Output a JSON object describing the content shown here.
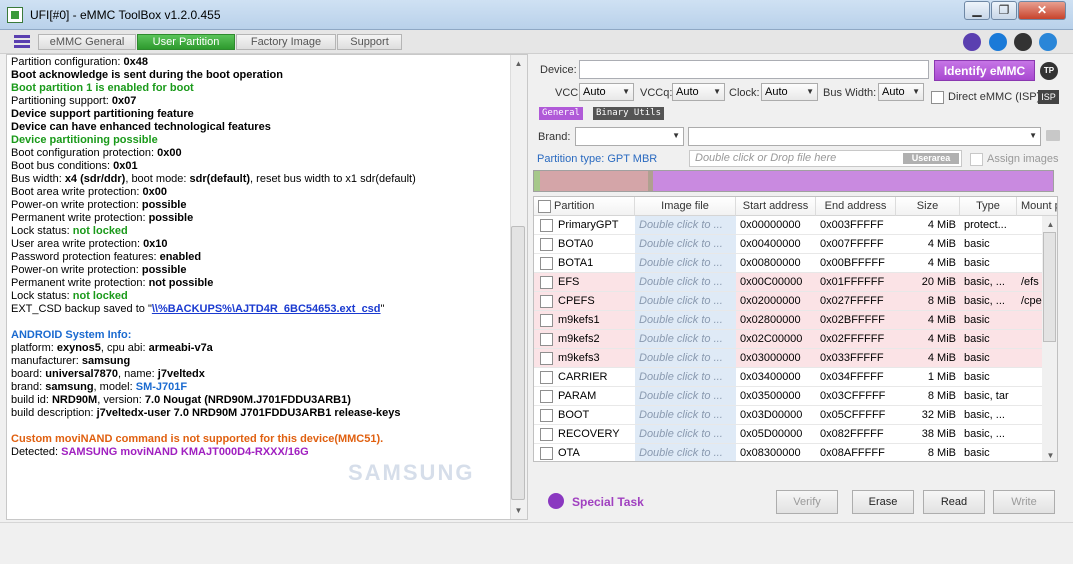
{
  "window": {
    "title": "UFI[#0] - eMMC ToolBox v1.2.0.455",
    "min": "▁",
    "restore": "❐",
    "close": "✕"
  },
  "tabs": [
    {
      "label": "eMMC General",
      "active": false
    },
    {
      "label": "User Partition",
      "active": true
    },
    {
      "label": "Factory Image",
      "active": false
    },
    {
      "label": "Support",
      "active": false
    }
  ],
  "log": {
    "lines": [
      {
        "p": "Partition configuration: ",
        "v": "0x48",
        "c": "b"
      },
      {
        "p": "",
        "v": " Boot acknowledge is sent during the boot operation",
        "c": "b"
      },
      {
        "p": "",
        "v": " Boot partition 1 is enabled for boot",
        "c": "green"
      },
      {
        "p": "Partitioning support: ",
        "v": "0x07",
        "c": "b"
      },
      {
        "p": "",
        "v": " Device support partitioning feature",
        "c": "b"
      },
      {
        "p": "",
        "v": " Device can have enhanced technological features",
        "c": "b"
      },
      {
        "p": "",
        "v": " Device partitioning possible",
        "c": "green"
      },
      {
        "p": "Boot configuration protection: ",
        "v": "0x00",
        "c": "b"
      },
      {
        "p": "Boot bus conditions: ",
        "v": "0x01",
        "c": "b"
      },
      {
        "p": " Bus width: ",
        "v": "x4 (sdr/ddr)",
        "c": "b",
        "p2": ", boot mode: ",
        "v2": "sdr(default)",
        "s": ", reset bus width to x1 sdr(default)"
      },
      {
        "p": "Boot area write protection: ",
        "v": "0x00",
        "c": "b"
      },
      {
        "p": " Power-on write protection: ",
        "v": "possible",
        "c": "b"
      },
      {
        "p": " Permanent write protection: ",
        "v": "possible",
        "c": "b"
      },
      {
        "p": " Lock status: ",
        "v": "not locked",
        "c": "green"
      },
      {
        "p": "User area write protection: ",
        "v": "0x10",
        "c": "b"
      },
      {
        "p": " Password protection features: ",
        "v": "enabled",
        "c": "b"
      },
      {
        "p": " Power-on write protection: ",
        "v": "possible",
        "c": "b"
      },
      {
        "p": " Permanent write protection: ",
        "v": "not possible",
        "c": "b"
      },
      {
        "p": " Lock status: ",
        "v": "not locked",
        "c": "green"
      },
      {
        "p": "EXT_CSD backup saved to \"",
        "v": "\\\\%BACKUPS%\\AJTD4R_6BC54653.ext_csd",
        "c": "link",
        "s": "\""
      },
      {
        "p": "",
        "v": "",
        "c": "blank"
      },
      {
        "p": "",
        "v": " ANDROID System Info:",
        "c": "blue"
      },
      {
        "p": " platform: ",
        "v": "exynos5",
        "c": "b",
        "p2": ", cpu abi: ",
        "v2": "armeabi-v7a"
      },
      {
        "p": " manufacturer: ",
        "v": "samsung",
        "c": "b"
      },
      {
        "p": " board: ",
        "v": "universal7870",
        "c": "b",
        "p2": ", name: ",
        "v2": "j7veltedx"
      },
      {
        "p": " brand: ",
        "v": "samsung",
        "c": "b",
        "p2": ", model: ",
        "v2": "SM-J701F",
        "c2": "blue"
      },
      {
        "p": " build id: ",
        "v": "NRD90M",
        "c": "b",
        "p2": ", version: ",
        "v2": "7.0 Nougat (NRD90M.J701FDDU3ARB1)"
      },
      {
        "p": " build description: ",
        "v": "j7veltedx-user 7.0 NRD90M J701FDDU3ARB1 release-keys",
        "c": "b"
      },
      {
        "p": "",
        "v": "",
        "c": "blank"
      },
      {
        "p": "",
        "v": "Custom moviNAND command is not supported for this device(MMC51).",
        "c": "orange"
      },
      {
        "p": "Detected: ",
        "v": "SAMSUNG moviNAND KMAJT000D4-RXXX/16G",
        "c": "magenta"
      }
    ],
    "watermark": "SAMSUNG"
  },
  "device": {
    "label": "Device:",
    "value": "",
    "identify_label": "Identify eMMC",
    "tp_label": "TP",
    "vcc_label": "VCC:",
    "vcc_value": "Auto",
    "vccq_label": "VCCq:",
    "vccq_value": "Auto",
    "clock_label": "Clock:",
    "clock_value": "Auto",
    "buswidth_label": "Bus Width:",
    "buswidth_value": "Auto",
    "direct_label": "Direct eMMC (ISP)",
    "isp_label": "ISP"
  },
  "subtabs": [
    "General",
    "Binary Utils"
  ],
  "brand": {
    "label": "Brand:",
    "value": "",
    "model_value": ""
  },
  "partition_type": "Partition type: GPT MBR",
  "dropzone_placeholder": "Double click or Drop file here",
  "userarea_label": "Userarea",
  "assign_images_label": "Assign images",
  "table": {
    "headers": [
      "Partition",
      "Image file",
      "Start address",
      "End address",
      "Size",
      "Type",
      "Mount p"
    ],
    "rows": [
      {
        "name": "PrimaryGPT",
        "image": "Double click to ...",
        "start": "0x00000000",
        "end": "0x003FFFFF",
        "size": "4 MiB",
        "type": "protect...",
        "mount": "",
        "hl": false
      },
      {
        "name": "BOTA0",
        "image": "Double click to ...",
        "start": "0x00400000",
        "end": "0x007FFFFF",
        "size": "4 MiB",
        "type": "basic",
        "mount": "",
        "hl": false
      },
      {
        "name": "BOTA1",
        "image": "Double click to ...",
        "start": "0x00800000",
        "end": "0x00BFFFFF",
        "size": "4 MiB",
        "type": "basic",
        "mount": "",
        "hl": false
      },
      {
        "name": "EFS",
        "image": "Double click to ...",
        "start": "0x00C00000",
        "end": "0x01FFFFFF",
        "size": "20 MiB",
        "type": "basic, ...",
        "mount": "/efs",
        "hl": true
      },
      {
        "name": "CPEFS",
        "image": "Double click to ...",
        "start": "0x02000000",
        "end": "0x027FFFFF",
        "size": "8 MiB",
        "type": "basic, ...",
        "mount": "/cpe",
        "hl": true
      },
      {
        "name": "m9kefs1",
        "image": "Double click to ...",
        "start": "0x02800000",
        "end": "0x02BFFFFF",
        "size": "4 MiB",
        "type": "basic",
        "mount": "",
        "hl": true
      },
      {
        "name": "m9kefs2",
        "image": "Double click to ...",
        "start": "0x02C00000",
        "end": "0x02FFFFFF",
        "size": "4 MiB",
        "type": "basic",
        "mount": "",
        "hl": true
      },
      {
        "name": "m9kefs3",
        "image": "Double click to ...",
        "start": "0x03000000",
        "end": "0x033FFFFF",
        "size": "4 MiB",
        "type": "basic",
        "mount": "",
        "hl": true
      },
      {
        "name": "CARRIER",
        "image": "Double click to ...",
        "start": "0x03400000",
        "end": "0x034FFFFF",
        "size": "1 MiB",
        "type": "basic",
        "mount": "",
        "hl": false
      },
      {
        "name": "PARAM",
        "image": "Double click to ...",
        "start": "0x03500000",
        "end": "0x03CFFFFF",
        "size": "8 MiB",
        "type": "basic, tar",
        "mount": "",
        "hl": false
      },
      {
        "name": "BOOT",
        "image": "Double click to ...",
        "start": "0x03D00000",
        "end": "0x05CFFFFF",
        "size": "32 MiB",
        "type": "basic, ...",
        "mount": "",
        "hl": false
      },
      {
        "name": "RECOVERY",
        "image": "Double click to ...",
        "start": "0x05D00000",
        "end": "0x082FFFFF",
        "size": "38 MiB",
        "type": "basic, ...",
        "mount": "",
        "hl": false
      },
      {
        "name": "OTA",
        "image": "Double click to ...",
        "start": "0x08300000",
        "end": "0x08AFFFFF",
        "size": "8 MiB",
        "type": "basic",
        "mount": "",
        "hl": false
      }
    ]
  },
  "actions": {
    "special_task": "Special Task",
    "verify": "Verify",
    "erase": "Erase",
    "read": "Read",
    "write": "Write"
  },
  "colors": {
    "accent_purple": "#b05ad8",
    "active_tab_green": "#3aa93a",
    "row_highlight": "#fbe3e6",
    "image_cell": "#dfeaf6",
    "map_pink": "#d4a5a8",
    "map_violet": "#c98ae0"
  }
}
